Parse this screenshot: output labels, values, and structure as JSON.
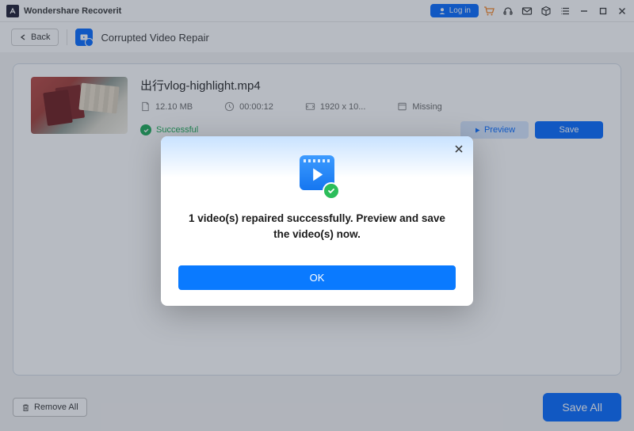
{
  "app": {
    "title": "Wondershare Recoverit"
  },
  "titlebar": {
    "login_label": "Log in"
  },
  "toolbar": {
    "back_label": "Back",
    "page_title": "Corrupted Video Repair"
  },
  "file": {
    "name": "出行vlog-highlight.mp4",
    "size": "12.10  MB",
    "duration": "00:00:12",
    "resolution": "1920 x 10...",
    "missing": "Missing",
    "status": "Successful"
  },
  "actions": {
    "preview_label": "Preview",
    "save_label": "Save"
  },
  "footer": {
    "remove_label": "Remove All",
    "saveall_label": "Save All"
  },
  "dialog": {
    "message": "1 video(s) repaired successfully. Preview and save the video(s) now.",
    "ok_label": "OK"
  }
}
